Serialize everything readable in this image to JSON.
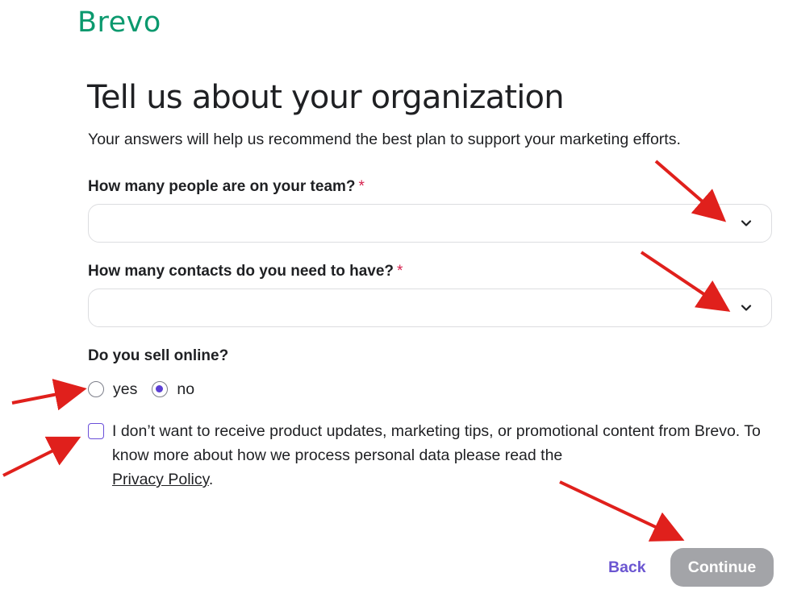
{
  "brand": {
    "logo_text": "Brevo",
    "color": "#0b996e"
  },
  "page": {
    "title": "Tell us about your organization",
    "subtitle": "Your answers will help us recommend the best plan to support your marketing efforts."
  },
  "form": {
    "team_size": {
      "label": "How many people are on your team?",
      "required_mark": "*",
      "value": "",
      "icon": "chevron-down-icon"
    },
    "contacts": {
      "label": "How many contacts do you need to have?",
      "required_mark": "*",
      "value": "",
      "icon": "chevron-down-icon"
    },
    "sell_online": {
      "label": "Do you sell online?",
      "options": [
        {
          "label": "yes",
          "checked": false
        },
        {
          "label": "no",
          "checked": true
        }
      ]
    },
    "consent": {
      "checked": false,
      "text": "I don’t want to receive product updates, marketing tips, or promotional content from Brevo. To know more about how we process personal data please read the",
      "link_text": "Privacy Policy",
      "suffix": "."
    }
  },
  "actions": {
    "back_label": "Back",
    "continue_label": "Continue"
  },
  "colors": {
    "accent": "#6b56d1",
    "radio_selected": "#5b3fd4",
    "required": "#d6224e",
    "continue_disabled_bg": "#a3a4a8",
    "annotation_arrow": "#e0201c"
  },
  "annotations": {
    "arrow_icon": "red-arrow-annotation"
  }
}
